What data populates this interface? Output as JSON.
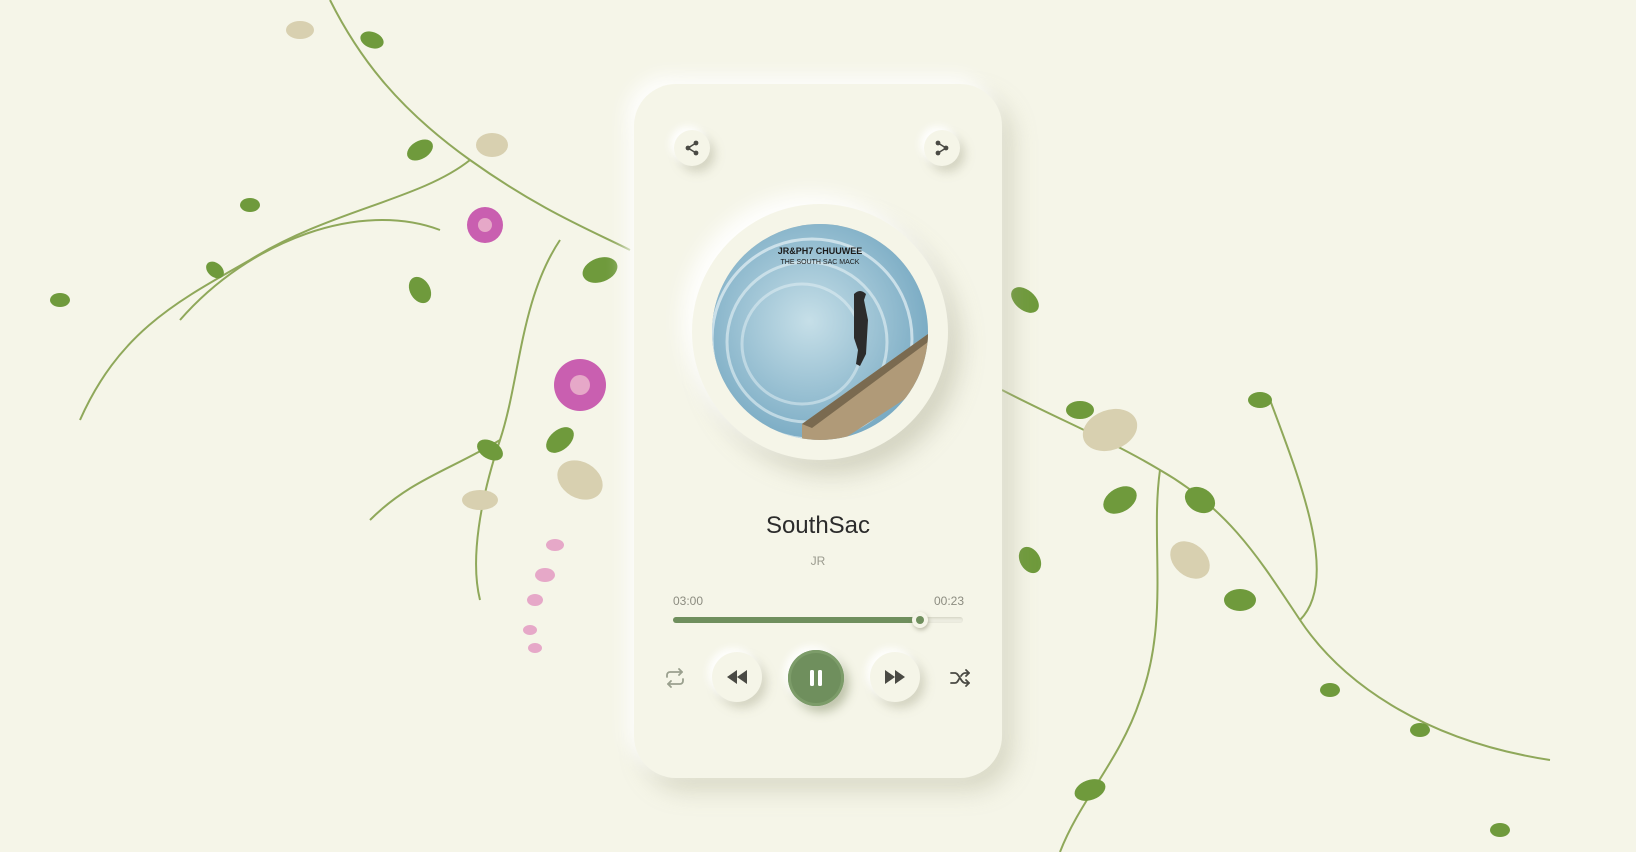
{
  "player": {
    "song_title": "SouthSac",
    "artist": "JR",
    "elapsed": "03:00",
    "duration": "00:23",
    "progress": 0.85,
    "album_art": {
      "line1": "JR&PH7 CHUUWEE",
      "line2": "THE SOUTH SAC MACK"
    }
  },
  "icons": {
    "top_left": "share-icon",
    "top_right": "share-icon",
    "repeat": "repeat-icon",
    "previous": "rewind-icon",
    "play_pause": "pause-icon",
    "next": "fast-forward-icon",
    "shuffle": "shuffle-icon"
  },
  "colors": {
    "background": "#f5f5e8",
    "accent": "#6f8f5d",
    "text": "#2b2b2b",
    "muted": "#9a9a8e"
  }
}
